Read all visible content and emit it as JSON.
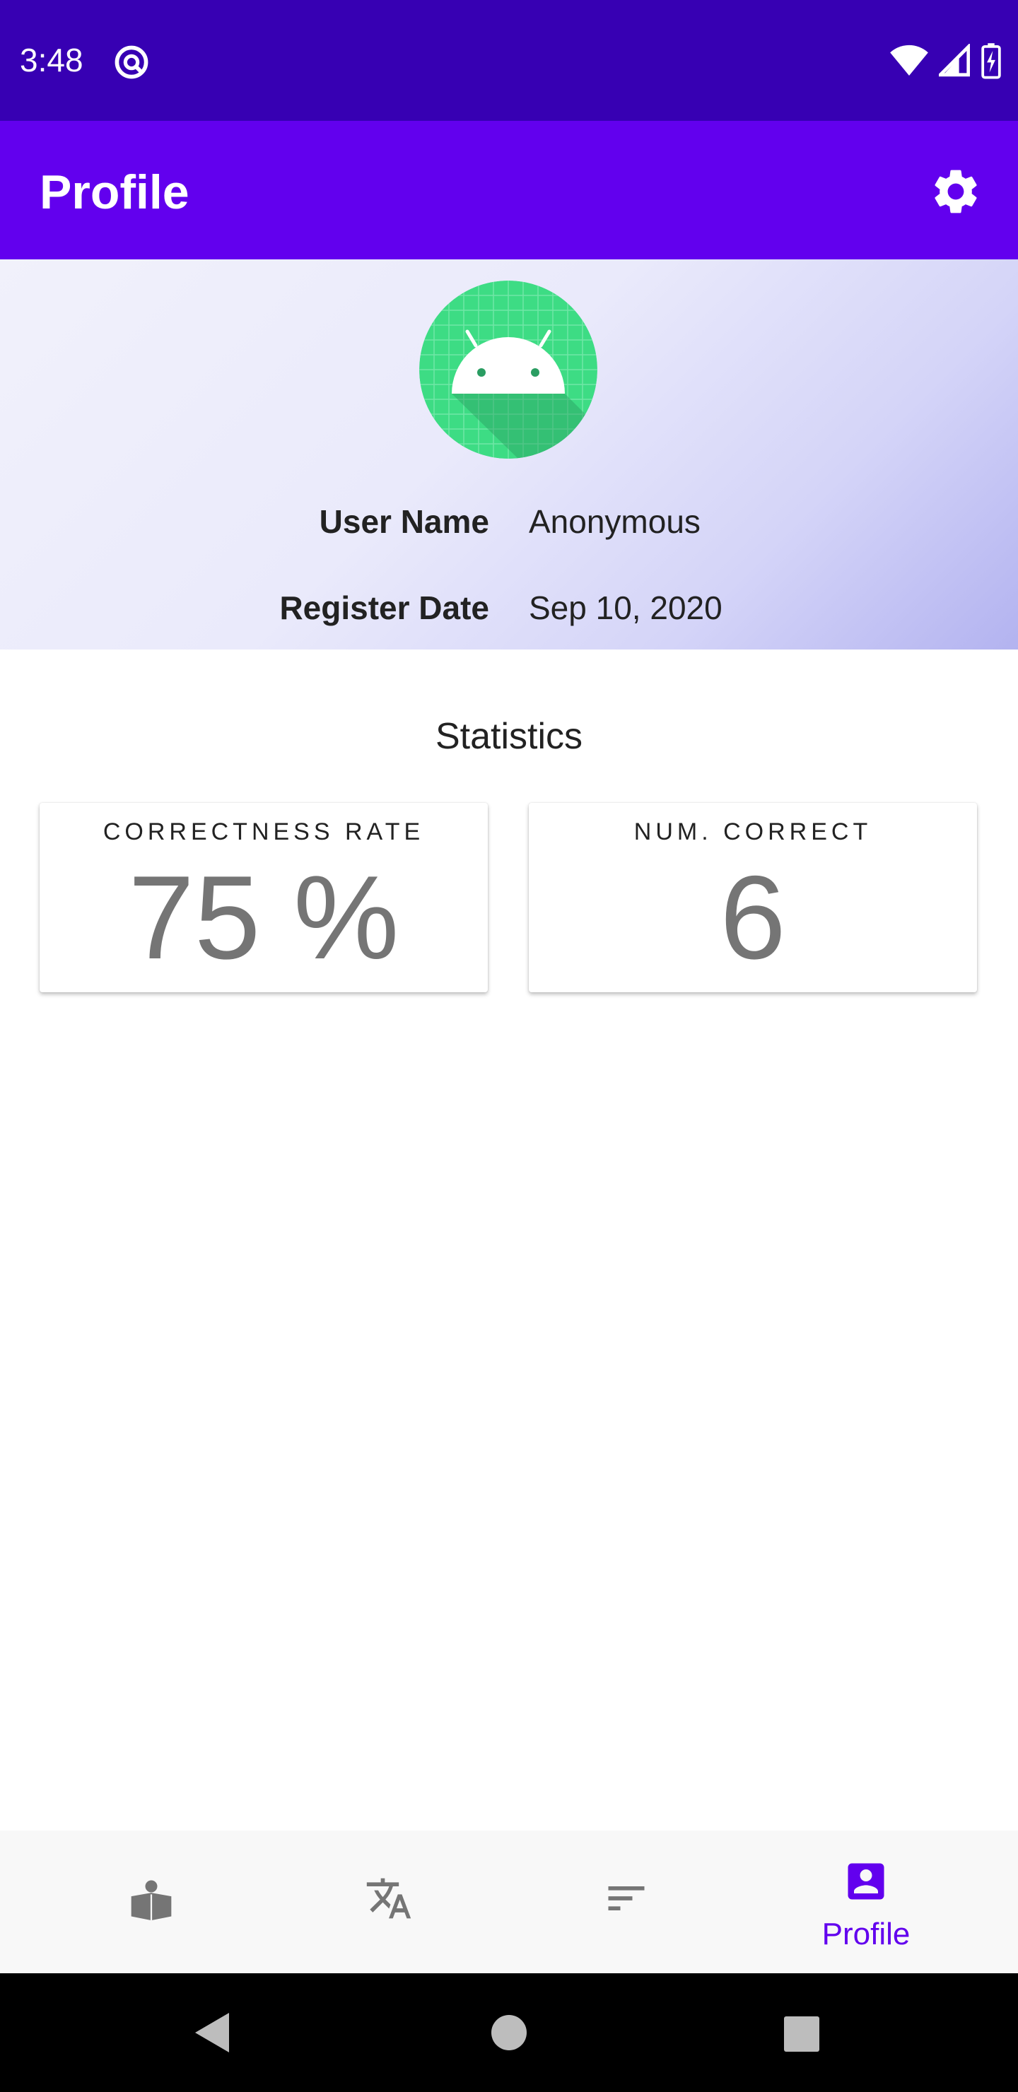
{
  "status_bar": {
    "time": "3:48"
  },
  "app_bar": {
    "title": "Profile"
  },
  "profile": {
    "user_name_label": "User Name",
    "user_name_value": "Anonymous",
    "register_date_label": "Register Date",
    "register_date_value": "Sep 10, 2020"
  },
  "statistics": {
    "title": "Statistics",
    "cards": [
      {
        "label": "CORRECTNESS RATE",
        "value": "75 %"
      },
      {
        "label": "NUM. CORRECT",
        "value": "6"
      }
    ]
  },
  "bottom_nav": {
    "items": [
      {
        "icon": "book-icon",
        "label": ""
      },
      {
        "icon": "translate-icon",
        "label": ""
      },
      {
        "icon": "sort-icon",
        "label": ""
      },
      {
        "icon": "account-box-icon",
        "label": "Profile",
        "active": true
      }
    ]
  },
  "colors": {
    "status_bar": "#3700b3",
    "app_bar": "#6200ee",
    "accent": "#6200ee",
    "icon_gray": "#757575"
  }
}
